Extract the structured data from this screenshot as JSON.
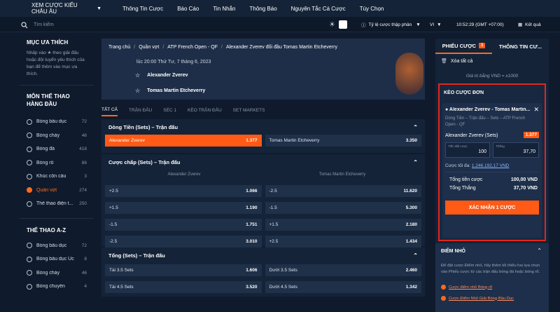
{
  "topnav": {
    "region": "XEM CƯỢC KIỂU CHÂU ÂU",
    "items": [
      "Thông Tin Cược",
      "Báo Cáo",
      "Tin Nhắn",
      "Thông Báo",
      "Nguyên Tắc Cá Cược",
      "Tùy Chọn"
    ]
  },
  "subbar": {
    "search_placeholder": "Tìm kiếm",
    "odds_label": "Tỷ lệ cược thập phân",
    "lang": "VI",
    "time": "10:52:29 (GMT +07:00)",
    "result": "Kết quả"
  },
  "sidebar": {
    "fav_title": "MỤC ƯA THÍCH",
    "fav_text": "Nhấp vào ★ theo giải đấu hoặc đội tuyển yêu thích của bạn để thêm vào mục ưa thích.",
    "top_title": "MÔN THỂ THAO HÀNG ĐẦU",
    "top_sports": [
      {
        "name": "Bóng bầu dục",
        "count": "72"
      },
      {
        "name": "Bóng chày",
        "count": "46"
      },
      {
        "name": "Bóng đá",
        "count": "418"
      },
      {
        "name": "Bóng rổ",
        "count": "86"
      },
      {
        "name": "Khúc côn cầu",
        "count": "3"
      },
      {
        "name": "Quần vợt",
        "count": "274"
      },
      {
        "name": "Thể thao điện t...",
        "count": "250"
      }
    ],
    "az_title": "THỂ THAO A-Z",
    "az_sports": [
      {
        "name": "Bóng bầu dục",
        "count": "72"
      },
      {
        "name": "Bóng bầu dục Úc",
        "count": "8"
      },
      {
        "name": "Bóng chày",
        "count": "46"
      },
      {
        "name": "Bóng chuyền",
        "count": "4"
      }
    ]
  },
  "main": {
    "breadcrumb": [
      "Trang chủ",
      "Quần vợt",
      "ATP French Open - QF",
      "Alexander Zverev đối đầu Tomas Martin Etcheverry"
    ],
    "match_time": "lúc 20:00 Thứ Tư, 7 tháng 6, 2023",
    "team1": "Alexander Zverev",
    "team2": "Tomas Martin Etcheverry",
    "tabs": [
      "TẤT CẢ",
      "TRẬN ĐẤU",
      "SÉC 1",
      "KÈO TRẬN ĐẤU",
      "SET MARKETS"
    ],
    "moneyline": {
      "title": "Dòng Tiền (Sets) – Trận đấu",
      "left": {
        "name": "Alexander Zverev",
        "odd": "1.377"
      },
      "right": {
        "name": "Tomas Martin Etcheverry",
        "odd": "3.350"
      }
    },
    "handicap": {
      "title": "Cược chấp (Sets) – Trận đấu",
      "col1": "Alexander Zverev",
      "col2": "Tomas Martin Etcheverry",
      "rows": [
        [
          {
            "l": "+2.5",
            "o": "1.066"
          },
          {
            "l": "-2.5",
            "o": "11.620"
          }
        ],
        [
          {
            "l": "+1.5",
            "o": "1.190"
          },
          {
            "l": "-1.5",
            "o": "5.300"
          }
        ],
        [
          {
            "l": "-1.5",
            "o": "1.751"
          },
          {
            "l": "+1.5",
            "o": "2.180"
          }
        ],
        [
          {
            "l": "-2.5",
            "o": "3.010"
          },
          {
            "l": "+2.5",
            "o": "1.434"
          }
        ]
      ]
    },
    "totals": {
      "title": "Tổng (Sets) – Trận đấu",
      "rows": [
        [
          {
            "l": "Tài 3.5 Sets",
            "o": "1.606"
          },
          {
            "l": "Dưới 3.5 Sets",
            "o": "2.460"
          }
        ],
        [
          {
            "l": "Tài 4.5 Sets",
            "o": "3.520"
          },
          {
            "l": "Dưới 4.5 Sets",
            "o": "1.342"
          }
        ]
      ]
    }
  },
  "betslip": {
    "tab1": "PHIẾU CƯỢC",
    "tab1_badge": "1",
    "tab2": "THÔNG TIN CƯ...",
    "clear": "Xóa tất cả",
    "big_bet": "Giá trị bằng VND = x1000",
    "single_title": "KÈO CƯỢC ĐƠN",
    "match": "Alexander Zverev - Tomas Martin...",
    "desc": "Dòng Tiền – Trận đấu – Sets – ATP French Open - QF",
    "pick": "Alexander Zverev (Sets)",
    "odd": "1.377",
    "stake_label": "Tiền đặt cược",
    "stake": "100",
    "win_label": "Thắng",
    "win": "37,70",
    "max_label": "Cược tối đa:",
    "max_value": "1.246.192,17 VND",
    "total_stake_label": "Tổng tiền cược",
    "total_stake": "100,00 VND",
    "total_win_label": "Tổng Thắng",
    "total_win": "37,70 VND",
    "confirm": "XÁC NHẬN 1 CƯỢC"
  },
  "tips": {
    "title": "ĐIỂM NHỎ",
    "text": "Để đặt cược Điểm nhỏ, hãy thêm tối thiểu hai lựa chọn vào Phiếu cược từ các trận đấu bóng đá hoặc bóng rổ.",
    "link1": "Cược điểm nhỏ Bóng rổ",
    "link2": "Cược Điểm Nhỏ Giải Bóng Bầu Dục"
  }
}
